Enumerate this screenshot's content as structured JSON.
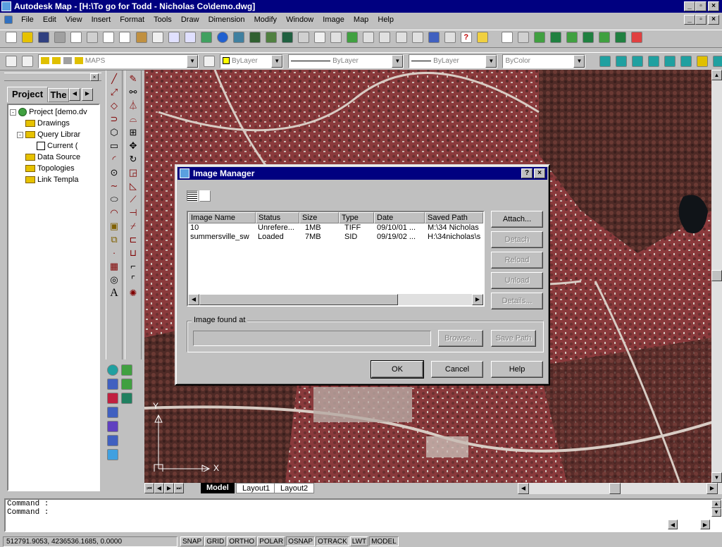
{
  "window": {
    "title": "Autodesk Map - [H:\\To go for Todd - Nicholas Co\\demo.dwg]"
  },
  "menu": [
    "File",
    "Edit",
    "View",
    "Insert",
    "Format",
    "Tools",
    "Draw",
    "Dimension",
    "Modify",
    "Window",
    "Image",
    "Map",
    "Help"
  ],
  "layers": {
    "current": "MAPS",
    "color": "ByLayer",
    "linetype": "ByLayer",
    "lineweight": "ByLayer",
    "plotstyle": "ByColor"
  },
  "project": {
    "tabs": [
      "Project",
      "The"
    ],
    "tree": [
      "Project [demo.dv",
      "Drawings",
      "Query Librar",
      "Current (",
      "Data Source",
      "Topologies",
      "Link Templa"
    ]
  },
  "layout_tabs": [
    "Model",
    "Layout1",
    "Layout2"
  ],
  "ucs": {
    "y": "Y",
    "x": "X"
  },
  "dialog": {
    "title": "Image Manager",
    "help_glyph": "?",
    "close_glyph": "×",
    "columns": [
      "Image Name",
      "Status",
      "Size",
      "Type",
      "Date",
      "Saved Path"
    ],
    "rows": [
      [
        "10",
        "Unrefere...",
        "1MB",
        "TIFF",
        "09/10/01 ...",
        "M:\\34 Nicholas"
      ],
      [
        "summersville_sw",
        "Loaded",
        "7MB",
        "SID",
        "09/19/02 ...",
        "H:\\34nicholas\\s"
      ]
    ],
    "side_buttons": [
      "Attach...",
      "Detach",
      "Reload",
      "Unload",
      "Details..."
    ],
    "found_label": "Image found at",
    "found_value": "",
    "browse": "Browse...",
    "save_path": "Save Path",
    "ok": "OK",
    "cancel": "Cancel",
    "help": "Help"
  },
  "command": {
    "lines": [
      "Command :",
      "Command :"
    ]
  },
  "status": {
    "coords": "512791.9053, 4236536.1685, 0.0000",
    "toggles": [
      "SNAP",
      "GRID",
      "ORTHO",
      "POLAR",
      "OSNAP",
      "OTRACK",
      "LWT",
      "MODEL"
    ]
  },
  "colors": {
    "titlebar": "#000080",
    "face": "#c0c0c0",
    "map_red": "#8a3a3c"
  }
}
